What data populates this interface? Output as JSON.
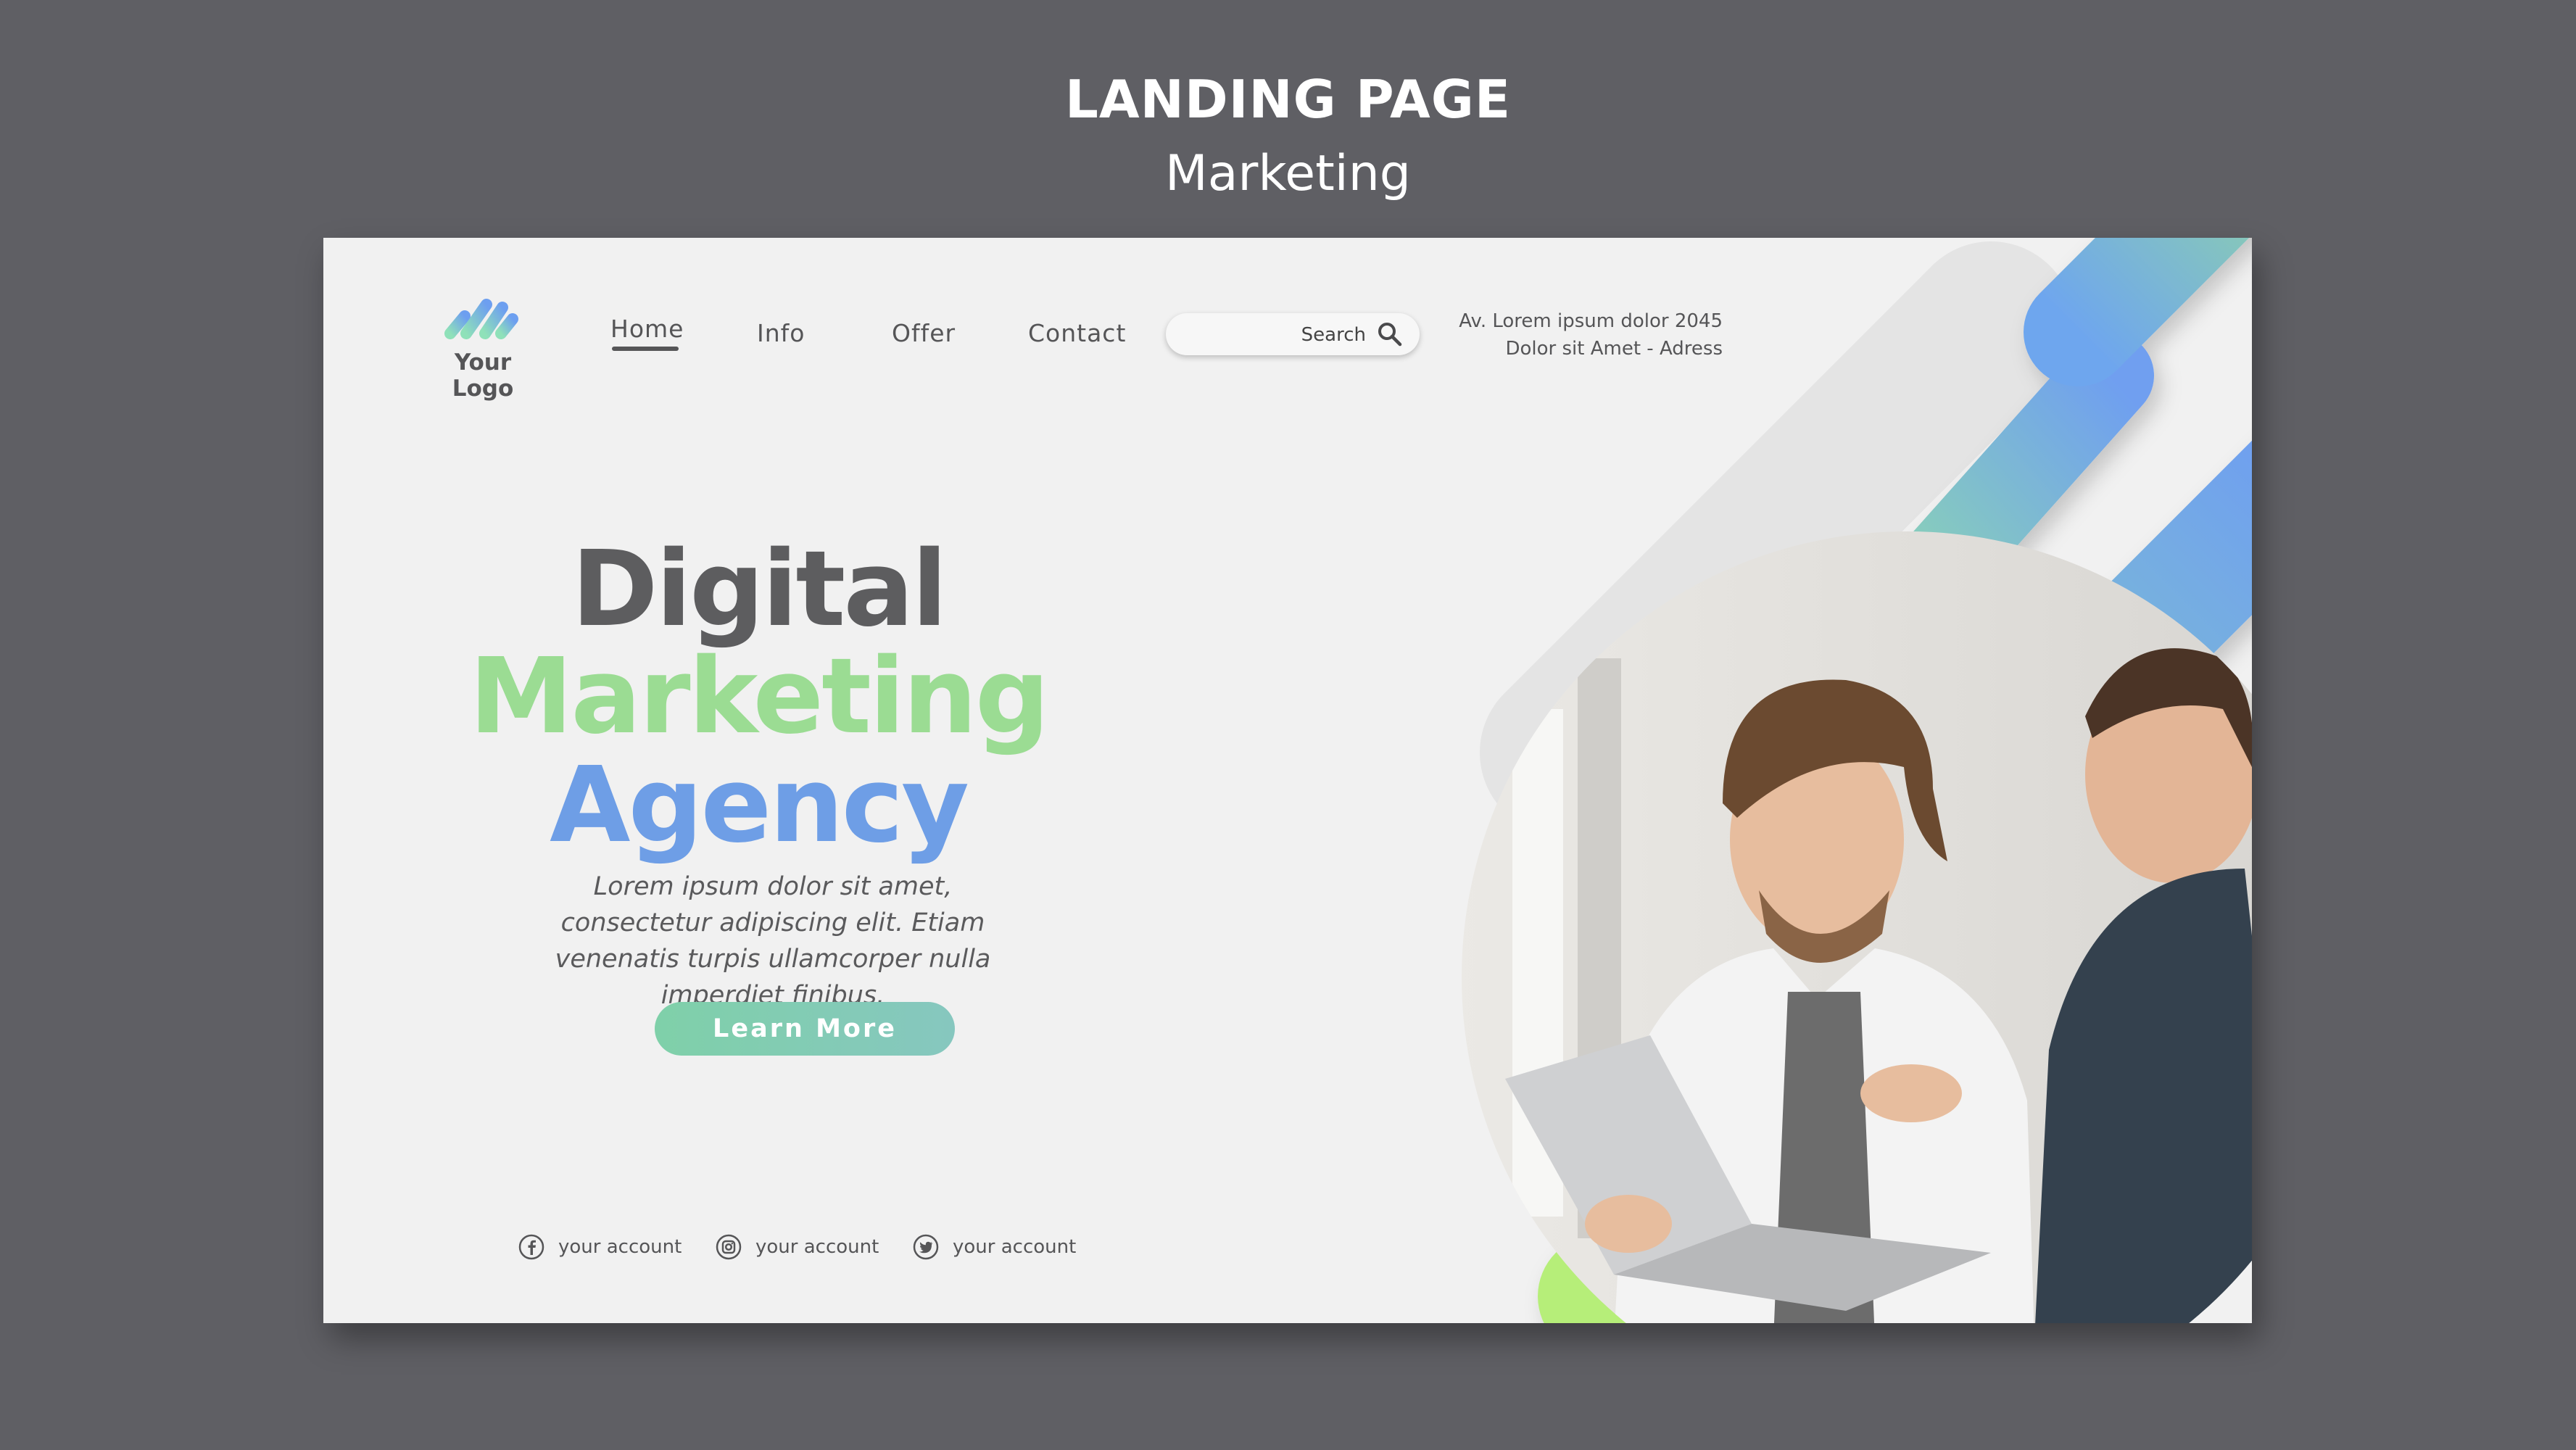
{
  "header": {
    "title": "LANDING PAGE",
    "subtitle": "Marketing"
  },
  "logo": {
    "text": "Your Logo"
  },
  "nav": {
    "items": [
      {
        "label": "Home",
        "active": true
      },
      {
        "label": "Info"
      },
      {
        "label": "Offer"
      },
      {
        "label": "Contact"
      }
    ]
  },
  "search": {
    "placeholder": "Search",
    "icon": "search-icon"
  },
  "address": {
    "line1": "Av. Lorem ipsum dolor 2045",
    "line2": "Dolor sit Amet - Adress"
  },
  "hero": {
    "line1": "Digital",
    "line2": "Marketing",
    "line3": "Agency",
    "description": "Lorem ipsum dolor sit amet, consectetur adipiscing elit. Etiam venenatis turpis ullamcorper nulla imperdiet finibus.",
    "button_label": "Learn More"
  },
  "social": [
    {
      "icon": "facebook-icon",
      "label": "your account"
    },
    {
      "icon": "instagram-icon",
      "label": "your account"
    },
    {
      "icon": "twitter-icon",
      "label": "your account"
    }
  ],
  "colors": {
    "background": "#5f5f64",
    "canvas": "#f1f1f1",
    "text_dark": "#5d5d5f",
    "accent_green": "#9bdc93",
    "accent_blue": "#6e9ee6",
    "button_gradient_start": "#7fd0a9",
    "button_gradient_end": "#86c7bf"
  }
}
